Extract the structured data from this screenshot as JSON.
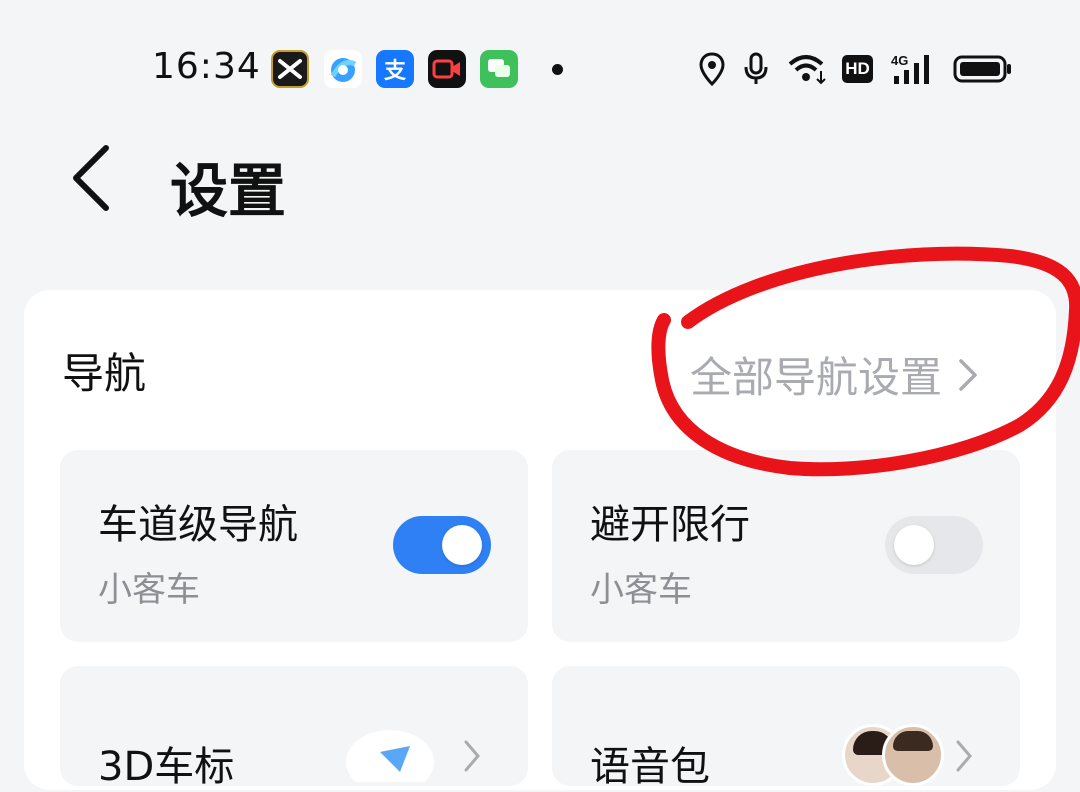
{
  "status_bar": {
    "time": "16:34",
    "apps": [
      "capcut-icon",
      "browser-icon",
      "alipay-icon",
      "video-recorder-icon",
      "messages-icon"
    ],
    "alipay_glyph": "支",
    "indicators": [
      "location-icon",
      "microphone-icon",
      "wifi-icon",
      "hd-icon",
      "cellular-4g-icon",
      "battery-icon"
    ],
    "hd_label": "HD",
    "network_label": "4G"
  },
  "header": {
    "title": "设置"
  },
  "navigation_section": {
    "title": "导航",
    "link_label": "全部导航设置"
  },
  "tiles": [
    {
      "title": "车道级导航",
      "subtitle": "小客车",
      "toggle_on": true
    },
    {
      "title": "避开限行",
      "subtitle": "小客车",
      "toggle_on": false
    },
    {
      "title": "3D车标"
    },
    {
      "title": "语音包"
    }
  ],
  "colors": {
    "accent": "#2f80f4",
    "annotation": "#e8141a",
    "background": "#f4f5f7"
  }
}
